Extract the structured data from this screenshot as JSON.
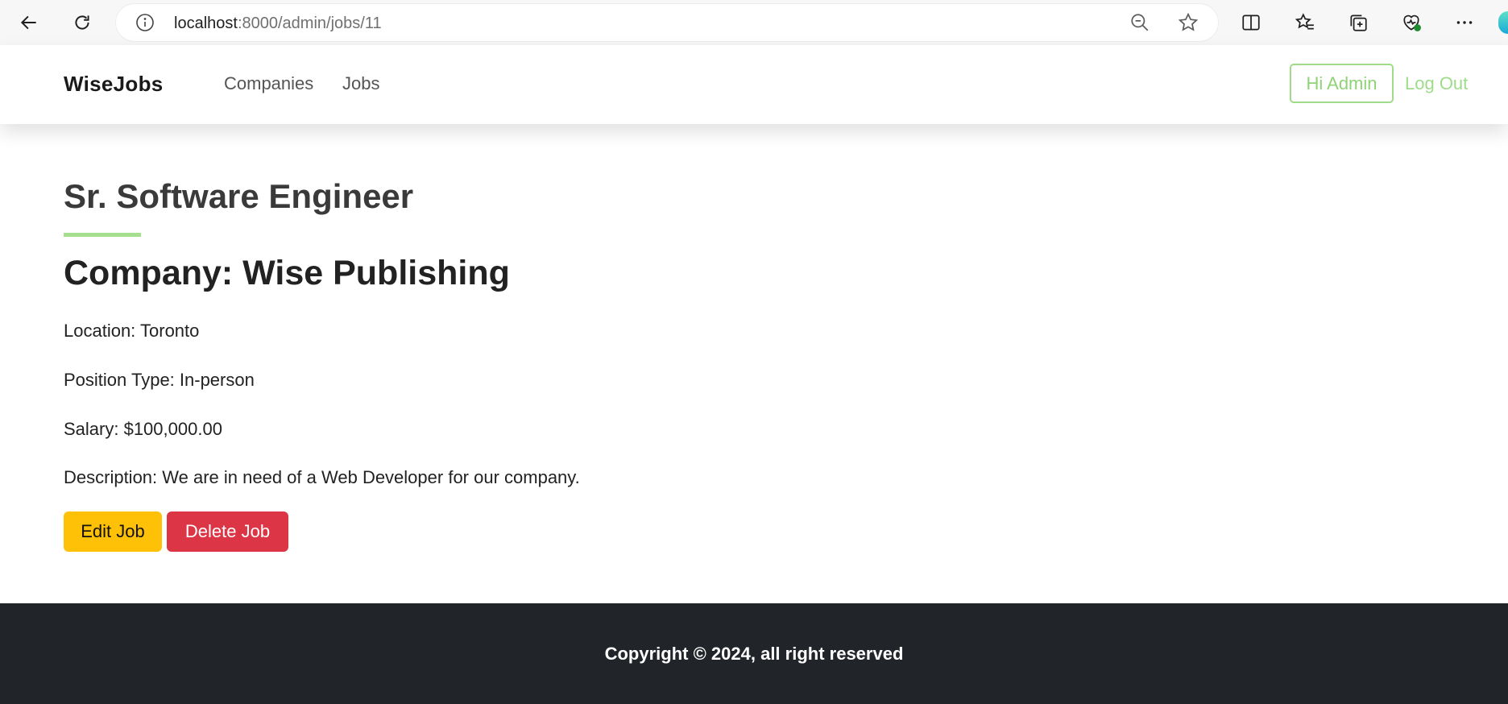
{
  "browser": {
    "url_host": "localhost",
    "url_path": ":8000/admin/jobs/11"
  },
  "navbar": {
    "brand": "WiseJobs",
    "links": [
      "Companies",
      "Jobs"
    ],
    "user_button": "Hi Admin",
    "logout": "Log Out"
  },
  "job": {
    "title": "Sr. Software Engineer",
    "company": "Company: Wise Publishing",
    "location": "Location: Toronto",
    "position_type": "Position Type: In-person",
    "salary": "Salary: $100,000.00",
    "description": "Description: We are in need of a Web Developer for our company."
  },
  "actions": {
    "edit": "Edit Job",
    "delete": "Delete Job"
  },
  "footer": {
    "copyright": "Copyright © 2024, all right reserved"
  },
  "colors": {
    "accent_green": "#a6e08f",
    "edit_button": "#ffc107",
    "delete_button": "#dc3545",
    "footer_bg": "#212529"
  }
}
